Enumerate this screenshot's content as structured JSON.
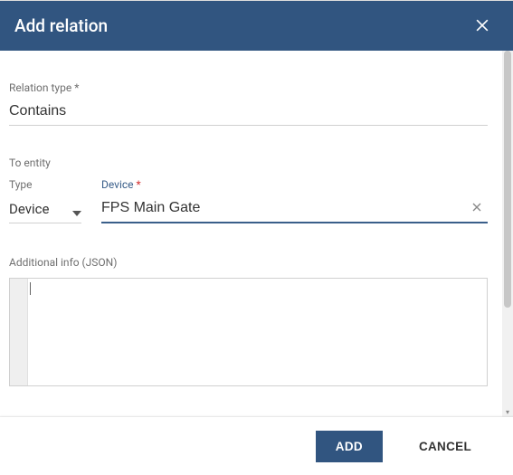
{
  "dialog": {
    "title": "Add relation"
  },
  "fields": {
    "relationType": {
      "label": "Relation type",
      "required": "*",
      "value": "Contains"
    },
    "toEntity": {
      "label": "To entity"
    },
    "type": {
      "label": "Type",
      "value": "Device"
    },
    "device": {
      "label": "Device",
      "required": "*",
      "value": "FPS Main Gate"
    },
    "additionalInfo": {
      "label": "Additional info (JSON)"
    }
  },
  "footer": {
    "add": "ADD",
    "cancel": "CANCEL"
  }
}
